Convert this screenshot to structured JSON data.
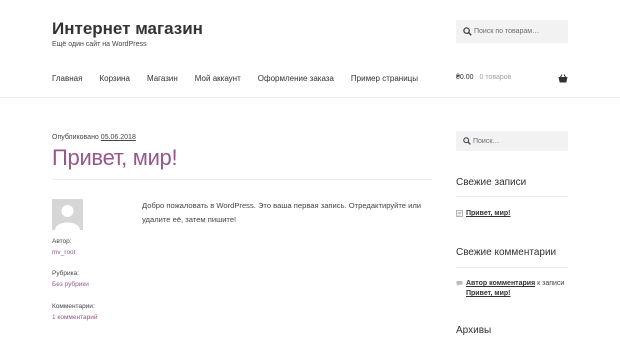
{
  "site": {
    "title": "Интернет магазин",
    "description": "Ещё один сайт на WordPress"
  },
  "header_search": {
    "placeholder": "Поиск по товарам…"
  },
  "nav": {
    "items": [
      "Главная",
      "Корзина",
      "Магазин",
      "Мой аккаунт",
      "Оформление заказа",
      "Пример страницы"
    ]
  },
  "cart": {
    "amount": "₴0.00",
    "count": "0 товаров"
  },
  "post": {
    "date_prefix": "Опубликовано",
    "date": "05.06.2018",
    "title": "Привет, мир!",
    "content": "Добро пожаловать в WordPress. Это ваша первая запись. Отредактируйте или удалите её, затем пишите!",
    "meta": {
      "author_label": "Автор:",
      "author": "mv_root",
      "category_label": "Рубрика:",
      "category": "Без рубрики",
      "comments_label": "Комментарии:",
      "comments": "1 комментарий"
    }
  },
  "sidebar": {
    "search_placeholder": "Поиск…",
    "recent_posts_title": "Свежие записи",
    "recent_posts": [
      "Привет, мир!"
    ],
    "recent_comments_title": "Свежие комментарии",
    "recent_comment": {
      "author": "Автор комментария",
      "connector": "к записи",
      "post": "Привет, мир!"
    },
    "archives_title": "Архивы"
  },
  "colors": {
    "accent": "#96588a",
    "text": "#43454b",
    "heading": "#333333",
    "input_bg": "#f2f2f2"
  }
}
